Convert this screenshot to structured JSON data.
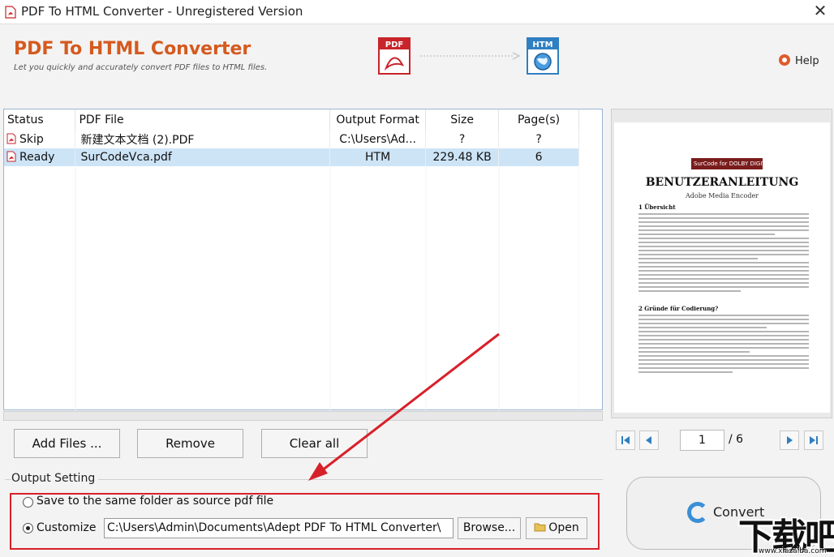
{
  "window": {
    "title": "PDF To HTML Converter - Unregistered Version",
    "close_glyph": "✕"
  },
  "header": {
    "brand": "PDF To HTML Converter",
    "tagline": "Let you quickly and accurately convert PDF files to HTML  files.",
    "from_badge": "PDF",
    "to_badge": "HTM",
    "help_label": "Help",
    "icons": [
      "pdf-file-icon",
      "dotted-arrow-icon",
      "htm-globe-icon",
      "lifebuoy-icon"
    ]
  },
  "file_list": {
    "columns": [
      "Status",
      "PDF File",
      "Output Format",
      "Size",
      "Page(s)"
    ],
    "rows": [
      {
        "status": "Skip",
        "file": "新建文本文档 (2).PDF",
        "output": "C:\\Users\\Ad...",
        "size": "?",
        "pages": "?",
        "selected": false
      },
      {
        "status": "Ready",
        "file": "SurCodeVca.pdf",
        "output": "HTM",
        "size": "229.48 KB",
        "pages": "6",
        "selected": true
      }
    ]
  },
  "preview": {
    "logo_text": "SurCode for DOLBY DIGITAL",
    "doc_title": "BENUTZERANLEITUNG",
    "doc_subtitle": "Adobe Media Encoder",
    "heading1": "1  Übersicht",
    "heading2": "2  Gründe für Codierung?",
    "current_page": "1",
    "total_pages": "/ 6"
  },
  "actions": {
    "add_files": "Add Files ...",
    "remove": "Remove",
    "clear_all": "Clear all",
    "convert": "Convert"
  },
  "output_setting": {
    "group_label": "Output Setting",
    "option_same_folder": "Save to the same folder as source pdf file",
    "option_customize": "Customize",
    "selected_option": "customize",
    "custom_path": "C:\\Users\\Admin\\Documents\\Adept PDF To HTML Converter\\",
    "browse_label": "Browse...",
    "open_label": "Open"
  },
  "watermark": {
    "text": "下载吧",
    "url": "www.xiazaiba.com"
  },
  "colors": {
    "brand": "#d45a1e",
    "highlight_row": "#cde4f7",
    "annotation_red": "#d8202a",
    "pdf_red": "#c8242b",
    "htm_blue": "#2f7fc1"
  }
}
